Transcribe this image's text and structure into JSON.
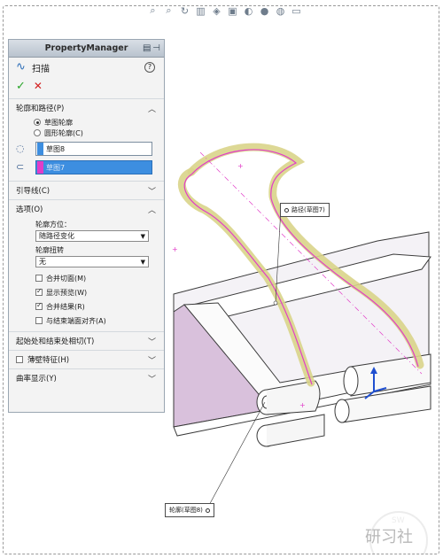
{
  "property_manager": {
    "title": "PropertyManager",
    "feature_name": "扫描",
    "sections": {
      "profile_path": {
        "title": "轮廓和路径(P)",
        "options": [
          "草图轮廓",
          "圆形轮廓(C)"
        ],
        "selected_option": 0,
        "profile_value": "草图8",
        "path_value": "草图7"
      },
      "guides": {
        "title": "引导线(C)"
      },
      "options": {
        "title": "选项(O)",
        "orientation_label": "轮廓方位：",
        "orientation_value": "随路径变化",
        "twist_label": "轮廓扭转",
        "twist_value": "无",
        "checkboxes": [
          {
            "label": "合并切面(M)",
            "checked": false
          },
          {
            "label": "显示预览(W)",
            "checked": true
          },
          {
            "label": "合并结果(R)",
            "checked": true
          },
          {
            "label": "与结束端面对齐(A)",
            "checked": false
          }
        ]
      },
      "start_end": {
        "title": "起始处和结束处相切(T)"
      },
      "thin": {
        "title": "薄壁特征(H)",
        "checked": false
      },
      "curvature": {
        "title": "曲率显示(Y)"
      }
    }
  },
  "callouts": {
    "path": "路径(草图7)",
    "profile": "轮廓(草图8)"
  },
  "watermark": {
    "line1": "SW",
    "line2": "研习社"
  },
  "colors": {
    "accent": "#3d8ee0",
    "profile_swatch": "#3d8ee0",
    "path_swatch": "#e23cc8",
    "sketch_pink": "#e23cc8",
    "sweep_yellow": "#d9d48a"
  },
  "toolbar_icons": [
    "zoom-fit-icon",
    "zoom-area-icon",
    "rotate-icon",
    "section-view-icon",
    "view-orientation-icon",
    "display-style-icon",
    "hide-show-icon",
    "appearance-icon",
    "scene-icon",
    "monitor-icon"
  ]
}
